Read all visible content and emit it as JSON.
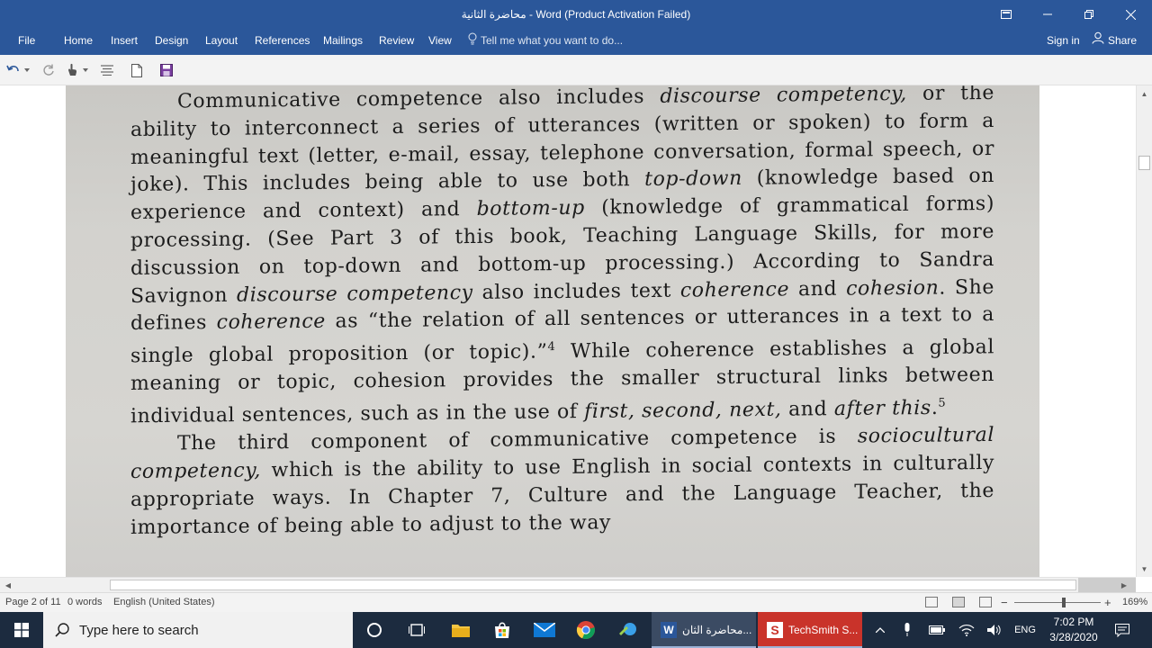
{
  "window": {
    "title": "محاضرة الثانية - Word (Product Activation Failed)"
  },
  "ribbon": {
    "tabs": [
      "File",
      "Home",
      "Insert",
      "Design",
      "Layout",
      "References",
      "Mailings",
      "Review",
      "View"
    ],
    "tell_me_placeholder": "Tell me what you want to do...",
    "sign_in": "Sign in",
    "share": "Share"
  },
  "quick_access": {
    "icons": [
      "undo-icon",
      "redo-icon",
      "touch-mode-icon",
      "format-icon",
      "new-document-icon",
      "save-icon"
    ]
  },
  "document": {
    "paragraphs": [
      {
        "segments": [
          {
            "t": "Communicative competence also includes "
          },
          {
            "t": "discourse competency,",
            "i": true
          },
          {
            "t": " or the ability to interconnect a series of utterances (written or spoken) to form a meaningful text (letter, e-mail, essay, telephone conversation, formal speech, or joke). This includes being able to use both "
          },
          {
            "t": "top-down",
            "i": true
          },
          {
            "t": " (knowledge based on experience and context) and "
          },
          {
            "t": "bottom-up",
            "i": true
          },
          {
            "t": " (knowledge of grammatical forms) processing. (See Part 3 of this book, Teaching Language Skills, for more discussion on top-down and bottom-up processing.) According to Sandra Savignon "
          },
          {
            "t": "discourse competency",
            "i": true
          },
          {
            "t": " also includes text "
          },
          {
            "t": "coherence",
            "i": true
          },
          {
            "t": " and "
          },
          {
            "t": "cohesion",
            "i": true
          },
          {
            "t": ". She defines "
          },
          {
            "t": "coherence",
            "i": true
          },
          {
            "t": " as “the relation of all sentences or utterances in a text to a single global proposition (or topic).”"
          },
          {
            "t": "4",
            "sup": true
          },
          {
            "t": " While coherence establishes a global meaning or topic, cohesion provides the smaller structural links between individual sentences, such as in the use of "
          },
          {
            "t": "first, second, next,",
            "i": true
          },
          {
            "t": " and "
          },
          {
            "t": "after this",
            "i": true
          },
          {
            "t": "."
          },
          {
            "t": "5",
            "sup": true
          }
        ]
      },
      {
        "segments": [
          {
            "t": "The third component of communicative competence is "
          },
          {
            "t": "sociocultural competency,",
            "i": true
          },
          {
            "t": " which is the ability to use English in social contexts in culturally appropriate ways. In Chapter 7, Culture and the Language Teacher, the importance of being able to adjust to the way"
          }
        ]
      }
    ]
  },
  "status": {
    "page": "Page 2 of 11",
    "words": "0 words",
    "language": "English (United States)",
    "zoom": "169%"
  },
  "taskbar": {
    "search_placeholder": "Type here to search",
    "apps": [
      {
        "name": "word",
        "label": "محاضرة الثان..."
      },
      {
        "name": "techsmith",
        "label": "TechSmith S..."
      }
    ],
    "language": "ENG",
    "time": "7:02 PM",
    "date": "3/28/2020"
  }
}
